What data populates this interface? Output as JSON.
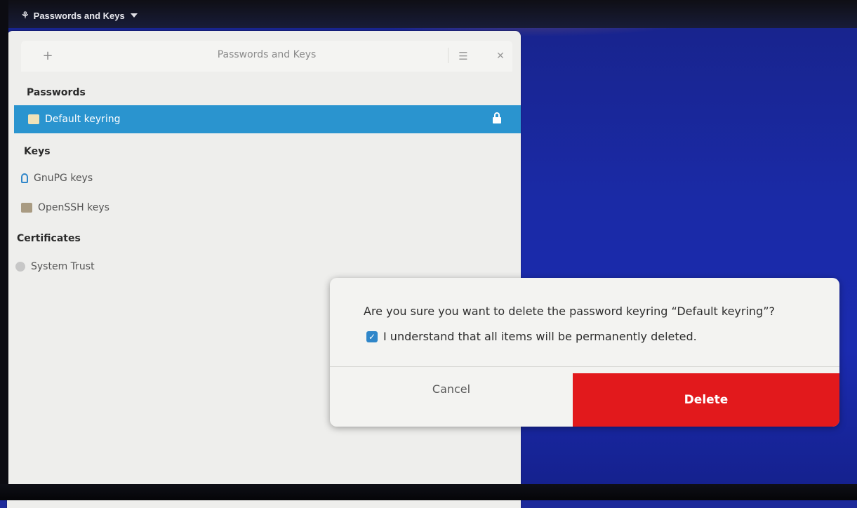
{
  "topbar": {
    "app_name": "Passwords and Keys",
    "app_icon": "seahorse-icon"
  },
  "window": {
    "title": "Passwords and Keys",
    "add_icon": "plus-icon",
    "menu_icon": "hamburger-icon",
    "close_icon": "close-icon"
  },
  "sidebar": {
    "sections": [
      {
        "title": "Passwords",
        "items": [
          {
            "label": "Default keyring",
            "icon": "folder-icon",
            "selected": true,
            "status_icon": "unlocked-icon"
          }
        ]
      },
      {
        "title": "Keys",
        "items": [
          {
            "label": "GnuPG keys",
            "icon": "key-icon"
          },
          {
            "label": "OpenSSH keys",
            "icon": "ssh-folder-icon"
          }
        ]
      },
      {
        "title": "Certificates",
        "items": [
          {
            "label": "System Trust",
            "icon": "certificate-icon"
          }
        ]
      }
    ]
  },
  "dialog": {
    "question": "Are you sure you want to delete the password keyring “Default keyring”?",
    "confirm_label": "I understand that all items will be permanently deleted.",
    "confirm_checked": true,
    "cancel_label": "Cancel",
    "delete_label": "Delete"
  },
  "colors": {
    "selection": "#2a94cf",
    "destructive": "#e2191c",
    "desktop": "#1b2bb0"
  }
}
